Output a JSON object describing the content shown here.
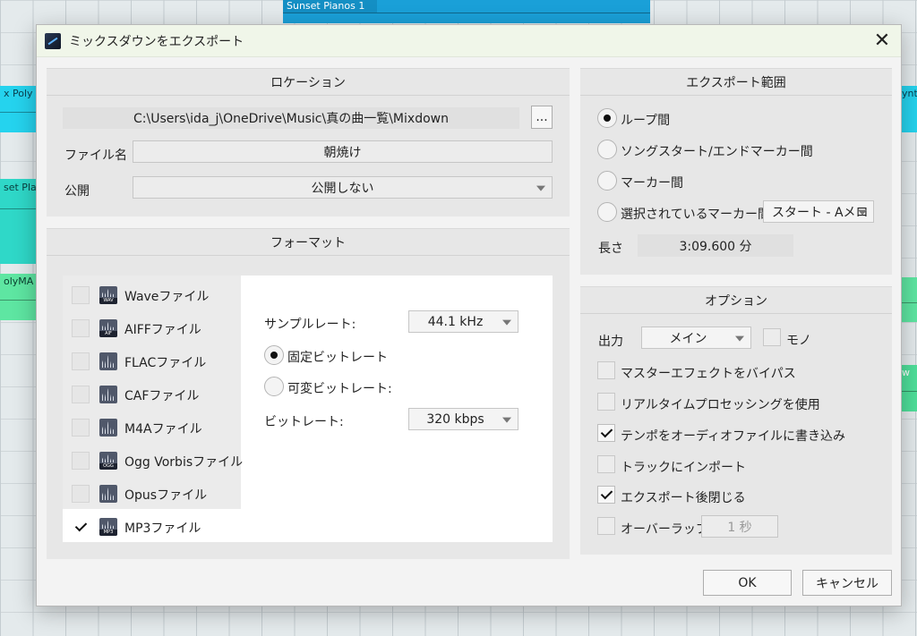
{
  "background": {
    "clip_top": "Sunset Pianos 1",
    "clip_left_1": "x Poly",
    "clip_left_2": "set Pla",
    "clip_left_3": "olyMA",
    "clip_right_1": "ynt",
    "clip_right_3": "w"
  },
  "dialog": {
    "title": "ミックスダウンをエクスポート",
    "close_glyph": "✕"
  },
  "location": {
    "header": "ロケーション",
    "path": "C:\\Users\\ida_j\\OneDrive\\Music\\真の曲一覧\\Mixdown",
    "browse_label": "...",
    "filename_label": "ファイル名",
    "filename_value": "朝焼け",
    "publish_label": "公開",
    "publish_value": "公開しない"
  },
  "format": {
    "header": "フォーマット",
    "items": [
      {
        "label": "Waveファイル",
        "tag": "WAV",
        "checked": false
      },
      {
        "label": "AIFFファイル",
        "tag": "AIF",
        "checked": false
      },
      {
        "label": "FLACファイル",
        "tag": "",
        "checked": false
      },
      {
        "label": "CAFファイル",
        "tag": "",
        "checked": false
      },
      {
        "label": "M4Aファイル",
        "tag": "",
        "checked": false
      },
      {
        "label": "Ogg Vorbisファイル",
        "tag": "OGG",
        "checked": false
      },
      {
        "label": "Opusファイル",
        "tag": "",
        "checked": false
      },
      {
        "label": "MP3ファイル",
        "tag": "MP3",
        "checked": true
      }
    ],
    "sample_rate_label": "サンプルレート:",
    "sample_rate_value": "44.1 kHz",
    "cbr_label": "固定ビットレート",
    "vbr_label": "可変ビットレート:",
    "bitrate_label": "ビットレート:",
    "bitrate_value": "320 kbps"
  },
  "range": {
    "header": "エクスポート範囲",
    "option_loop": "ループ間",
    "option_song": "ソングスタート/エンドマーカー間",
    "option_marker": "マーカー間",
    "option_selected": "選択されているマーカー間",
    "selected_marker_value": "スタート - Aメロ",
    "length_label": "長さ",
    "length_value": "3:09.600 分"
  },
  "options": {
    "header": "オプション",
    "output_label": "出力",
    "output_value": "メイン",
    "mono_label": "モノ",
    "bypass_master": "マスターエフェクトをバイパス",
    "realtime": "リアルタイムプロセッシングを使用",
    "write_tempo": "テンポをオーディオファイルに書き込み",
    "import_track": "トラックにインポート",
    "close_after": "エクスポート後閉じる",
    "overlap_label": "オーバーラップ",
    "overlap_value": "1 秒"
  },
  "buttons": {
    "ok": "OK",
    "cancel": "キャンセル"
  }
}
